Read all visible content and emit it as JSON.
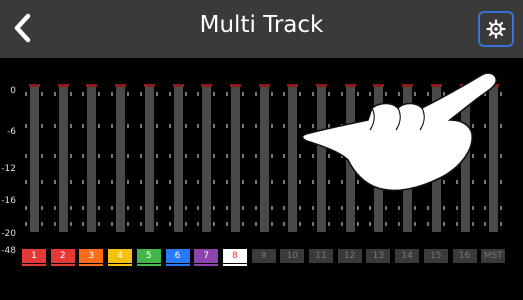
{
  "header": {
    "title": "Multi Track",
    "back_icon": "chevron-left-icon",
    "settings_icon": "gear-icon",
    "highlight_color": "#3b6fd6"
  },
  "scale": [
    "0",
    "-6",
    "-12",
    "-16",
    "-20",
    "-48"
  ],
  "channels": [
    {
      "label": "1",
      "color": "#e53935",
      "active": true
    },
    {
      "label": "2",
      "color": "#e53935",
      "active": true
    },
    {
      "label": "3",
      "color": "#ff6d1a",
      "active": true
    },
    {
      "label": "4",
      "color": "#f4c20d",
      "active": true
    },
    {
      "label": "5",
      "color": "#43b649",
      "active": true
    },
    {
      "label": "6",
      "color": "#2979ff",
      "active": true
    },
    {
      "label": "7",
      "color": "#8e44ad",
      "active": true
    },
    {
      "label": "8",
      "color": "#ffffff",
      "active": true
    },
    {
      "label": "9",
      "color": "#555555",
      "active": false
    },
    {
      "label": "10",
      "color": "#555555",
      "active": false
    },
    {
      "label": "11",
      "color": "#555555",
      "active": false
    },
    {
      "label": "12",
      "color": "#555555",
      "active": false
    },
    {
      "label": "13",
      "color": "#555555",
      "active": false
    },
    {
      "label": "14",
      "color": "#555555",
      "active": false
    },
    {
      "label": "15",
      "color": "#555555",
      "active": false
    },
    {
      "label": "16",
      "color": "#555555",
      "active": false
    },
    {
      "label": "MST",
      "color": "#555555",
      "active": false
    }
  ]
}
